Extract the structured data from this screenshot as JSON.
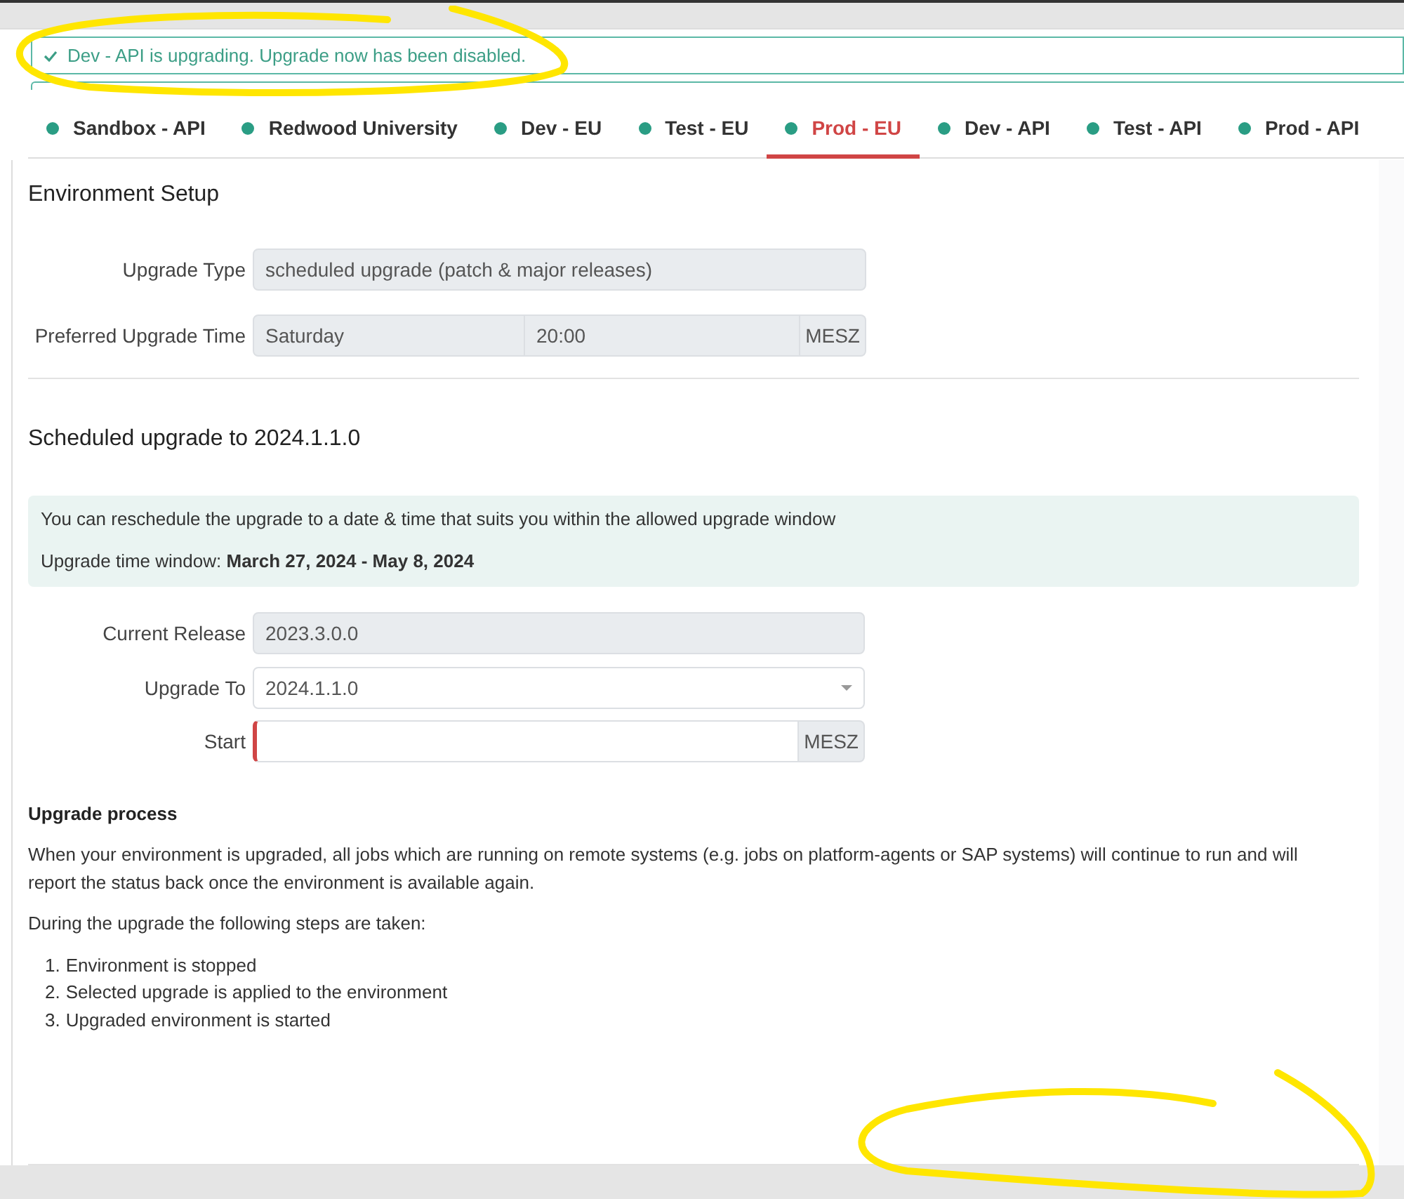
{
  "notification": {
    "text": "Dev - API is upgrading. Upgrade now has been disabled."
  },
  "tabs": [
    {
      "label": "Sandbox - API",
      "selected": false
    },
    {
      "label": "Redwood University",
      "selected": false
    },
    {
      "label": "Dev - EU",
      "selected": false
    },
    {
      "label": "Test - EU",
      "selected": false
    },
    {
      "label": "Prod - EU",
      "selected": true
    },
    {
      "label": "Dev - API",
      "selected": false
    },
    {
      "label": "Test - API",
      "selected": false
    },
    {
      "label": "Prod - API",
      "selected": false
    }
  ],
  "environment_setup": {
    "title": "Environment Setup",
    "upgrade_type": {
      "label": "Upgrade Type",
      "value": "scheduled upgrade (patch & major releases)"
    },
    "preferred_upgrade_time": {
      "label": "Preferred Upgrade Time",
      "day": "Saturday",
      "time": "20:00",
      "timezone": "MESZ"
    }
  },
  "scheduled_upgrade": {
    "title": "Scheduled upgrade to 2024.1.1.0",
    "info": "You can reschedule the upgrade to a date & time that suits you within the allowed upgrade window",
    "window": "Upgrade time window: **March 27, 2024 - May 8, 2024**",
    "current_release": {
      "label": "Current Release",
      "value": "2023.3.0.0"
    },
    "upgrade_to": {
      "label": "Upgrade To",
      "value": "2024.1.1.0"
    },
    "start": {
      "label": "Start",
      "timezone": "MESZ",
      "invalid": true
    }
  },
  "upgrade_process": {
    "title": "Upgrade process",
    "paragraphs": [
      "When your environment is upgraded, all jobs which are running on remote systems (e.g. jobs on platform-agents or SAP systems) will continue to run and will report the status back once the environment is available again.",
      "During the upgrade the following steps are taken:"
    ],
    "steps": [
      {
        "number": "1.",
        "text": "Environment is stopped"
      },
      {
        "number": "2.",
        "text": "Selected upgrade is applied to the environment"
      },
      {
        "number": "3.",
        "text": "Upgraded environment is started"
      }
    ]
  }
}
